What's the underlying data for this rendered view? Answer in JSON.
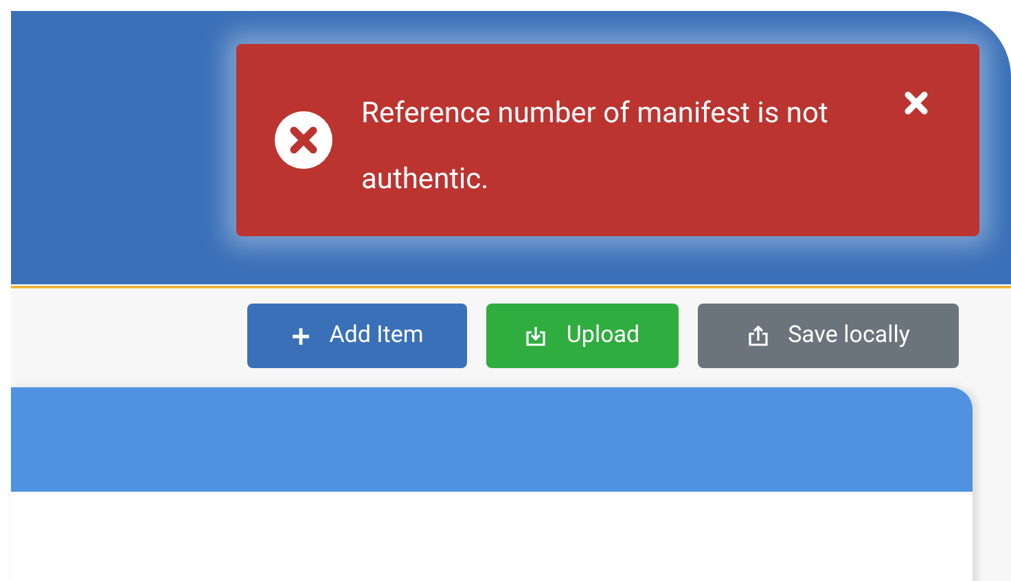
{
  "toast": {
    "kind": "error",
    "message": "Reference number of manifest is not authentic."
  },
  "toolbar": {
    "buttons": [
      {
        "label": "Add Item",
        "kind": "add"
      },
      {
        "label": "Upload",
        "kind": "upload"
      },
      {
        "label": "Save locally",
        "kind": "save"
      }
    ]
  }
}
